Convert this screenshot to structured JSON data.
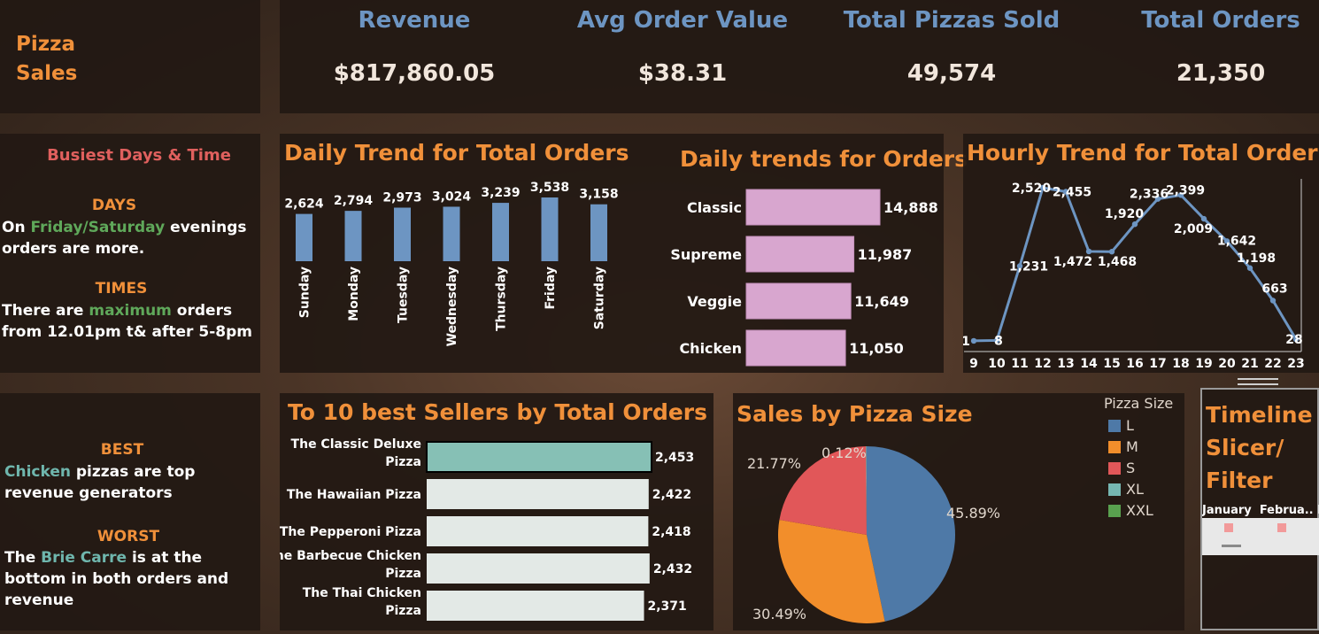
{
  "header": {
    "title_line1": "Pizza",
    "title_line2": "Sales"
  },
  "kpis": [
    {
      "title": "Revenue",
      "value": "$817,860.05"
    },
    {
      "title": "Avg Order Value",
      "value": "$38.31"
    },
    {
      "title": "Total Pizzas Sold",
      "value": "49,574"
    },
    {
      "title": "Total Orders",
      "value": "21,350"
    }
  ],
  "busiest": {
    "title": "Busiest Days & Time",
    "days_head": "DAYS",
    "days_pre": "On ",
    "days_hl": "Friday/Saturday",
    "days_post": " evenings orders are more.",
    "times_head": "TIMES",
    "times_pre": "There are ",
    "times_hl": "maximum",
    "times_post": " orders from 12.01pm t& after 5-8pm"
  },
  "best_worst": {
    "best_head": "BEST",
    "best_hl": "Chicken",
    "best_post": " pizzas are top revenue generators",
    "worst_head": "WORST",
    "worst_pre": "The ",
    "worst_hl": "Brie Carre",
    "worst_post": " is at the bottom in both orders and revenue"
  },
  "timeline": {
    "title": "Timeline Slicer/ Filter",
    "months": "January  Februa.. M"
  },
  "colors": {
    "bar_blue": "#6d95c2",
    "bar_pink": "#d8a6cf",
    "bar_teal": "#86c0b5",
    "bar_light": "#e3e9e6",
    "pie_L": "#4e79a7",
    "pie_M": "#f28e2b",
    "pie_S": "#e15759",
    "pie_XL": "#76b7b2",
    "pie_XXL": "#59a14f"
  },
  "chart_data": [
    {
      "id": "daily",
      "type": "bar",
      "title": "Daily Trend for Total Orders",
      "categories": [
        "Sunday",
        "Monday",
        "Tuesday",
        "Wednesday",
        "Thursday",
        "Friday",
        "Saturday"
      ],
      "values": [
        2624,
        2794,
        2973,
        3024,
        3239,
        3538,
        3158
      ],
      "labels": [
        "2,624",
        "2,794",
        "2,973",
        "3,024",
        "3,239",
        "3,538",
        "3,158"
      ]
    },
    {
      "id": "category",
      "type": "bar",
      "orientation": "horizontal",
      "title": "Daily trends for Orders",
      "categories": [
        "Classic",
        "Supreme",
        "Veggie",
        "Chicken"
      ],
      "values": [
        14888,
        11987,
        11649,
        11050
      ],
      "labels": [
        "14,888",
        "11,987",
        "11,649",
        "11,050"
      ]
    },
    {
      "id": "hourly",
      "type": "line",
      "title": "Hourly Trend for Total Orders",
      "x": [
        9,
        10,
        11,
        12,
        13,
        14,
        15,
        16,
        17,
        18,
        19,
        20,
        21,
        22,
        23
      ],
      "x_labels": [
        "9",
        "10",
        "11",
        "12",
        "13",
        "14",
        "15",
        "16",
        "17",
        "18",
        "19",
        "20",
        "21",
        "22",
        "23"
      ],
      "values": [
        1,
        8,
        1231,
        2520,
        2455,
        1472,
        1468,
        1920,
        2336,
        2399,
        2009,
        1642,
        1198,
        663,
        28
      ],
      "labels": [
        "1",
        "8",
        "1,231",
        "2,520",
        "2,455",
        "1,472",
        "1,468",
        "1,920",
        "2,336",
        "2,399",
        "2,009",
        "1,642",
        "1,198",
        "663",
        "28"
      ]
    },
    {
      "id": "top_sellers",
      "type": "bar",
      "orientation": "horizontal",
      "title": "To 10 best Sellers by Total Orders",
      "categories": [
        [
          "The Classic Deluxe",
          "Pizza"
        ],
        [
          "The Hawaiian Pizza"
        ],
        [
          "The Pepperoni Pizza"
        ],
        [
          "The Barbecue Chicken",
          "Pizza"
        ],
        [
          "The Thai Chicken",
          "Pizza"
        ]
      ],
      "values": [
        2453,
        2422,
        2418,
        2432,
        2371
      ],
      "labels": [
        "2,453",
        "2,422",
        "2,418",
        "2,432",
        "2,371"
      ]
    },
    {
      "id": "size",
      "type": "pie",
      "title": "Sales by Pizza Size",
      "legend_title": "Pizza Size",
      "categories": [
        "L",
        "M",
        "S",
        "XL",
        "XXL"
      ],
      "values": [
        45.89,
        30.49,
        21.77,
        0.12,
        0.0
      ],
      "shown_labels": [
        "45.89%",
        "30.49%",
        "21.77%",
        "0.12%"
      ],
      "legend": "right"
    }
  ]
}
